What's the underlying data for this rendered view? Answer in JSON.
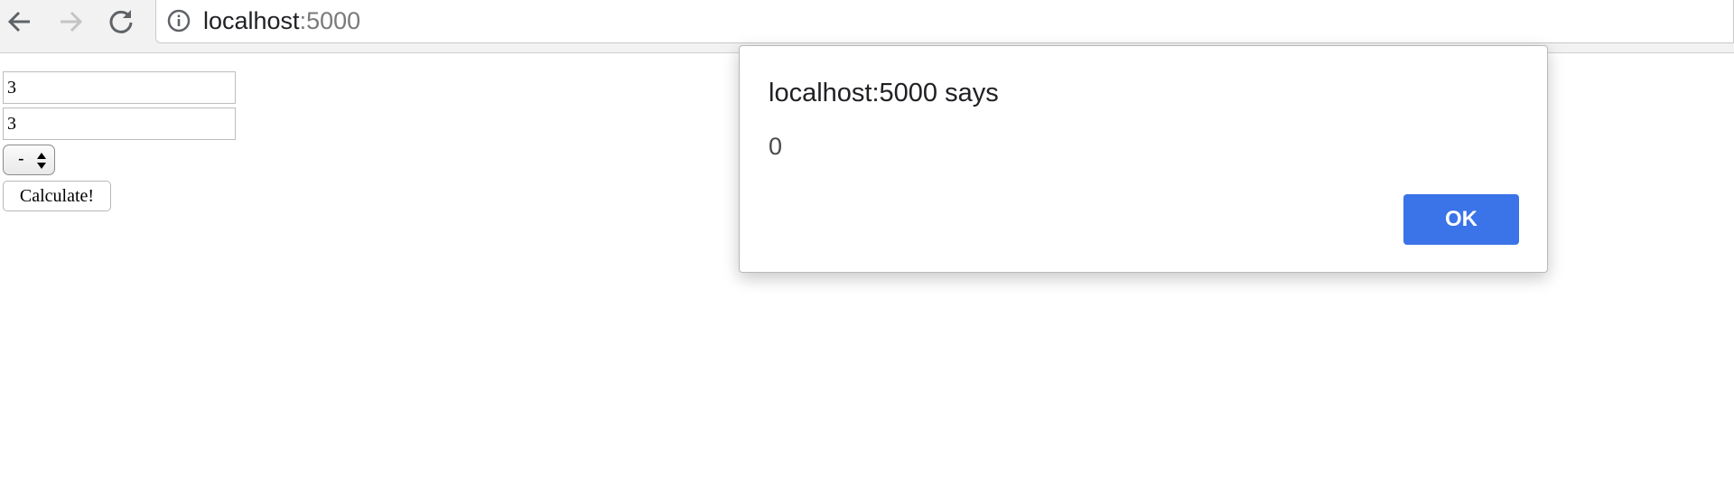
{
  "browser": {
    "url_host": "localhost",
    "url_port": ":5000"
  },
  "form": {
    "first_number": "3",
    "second_number": "3",
    "operator": "-",
    "calculate_label": "Calculate!"
  },
  "alert": {
    "title": "localhost:5000 says",
    "message": "0",
    "ok_label": "OK",
    "ok_color": "#3b73e8"
  },
  "icons": [
    "back-arrow-icon",
    "forward-arrow-icon",
    "reload-icon",
    "info-icon",
    "select-arrows-icon"
  ]
}
